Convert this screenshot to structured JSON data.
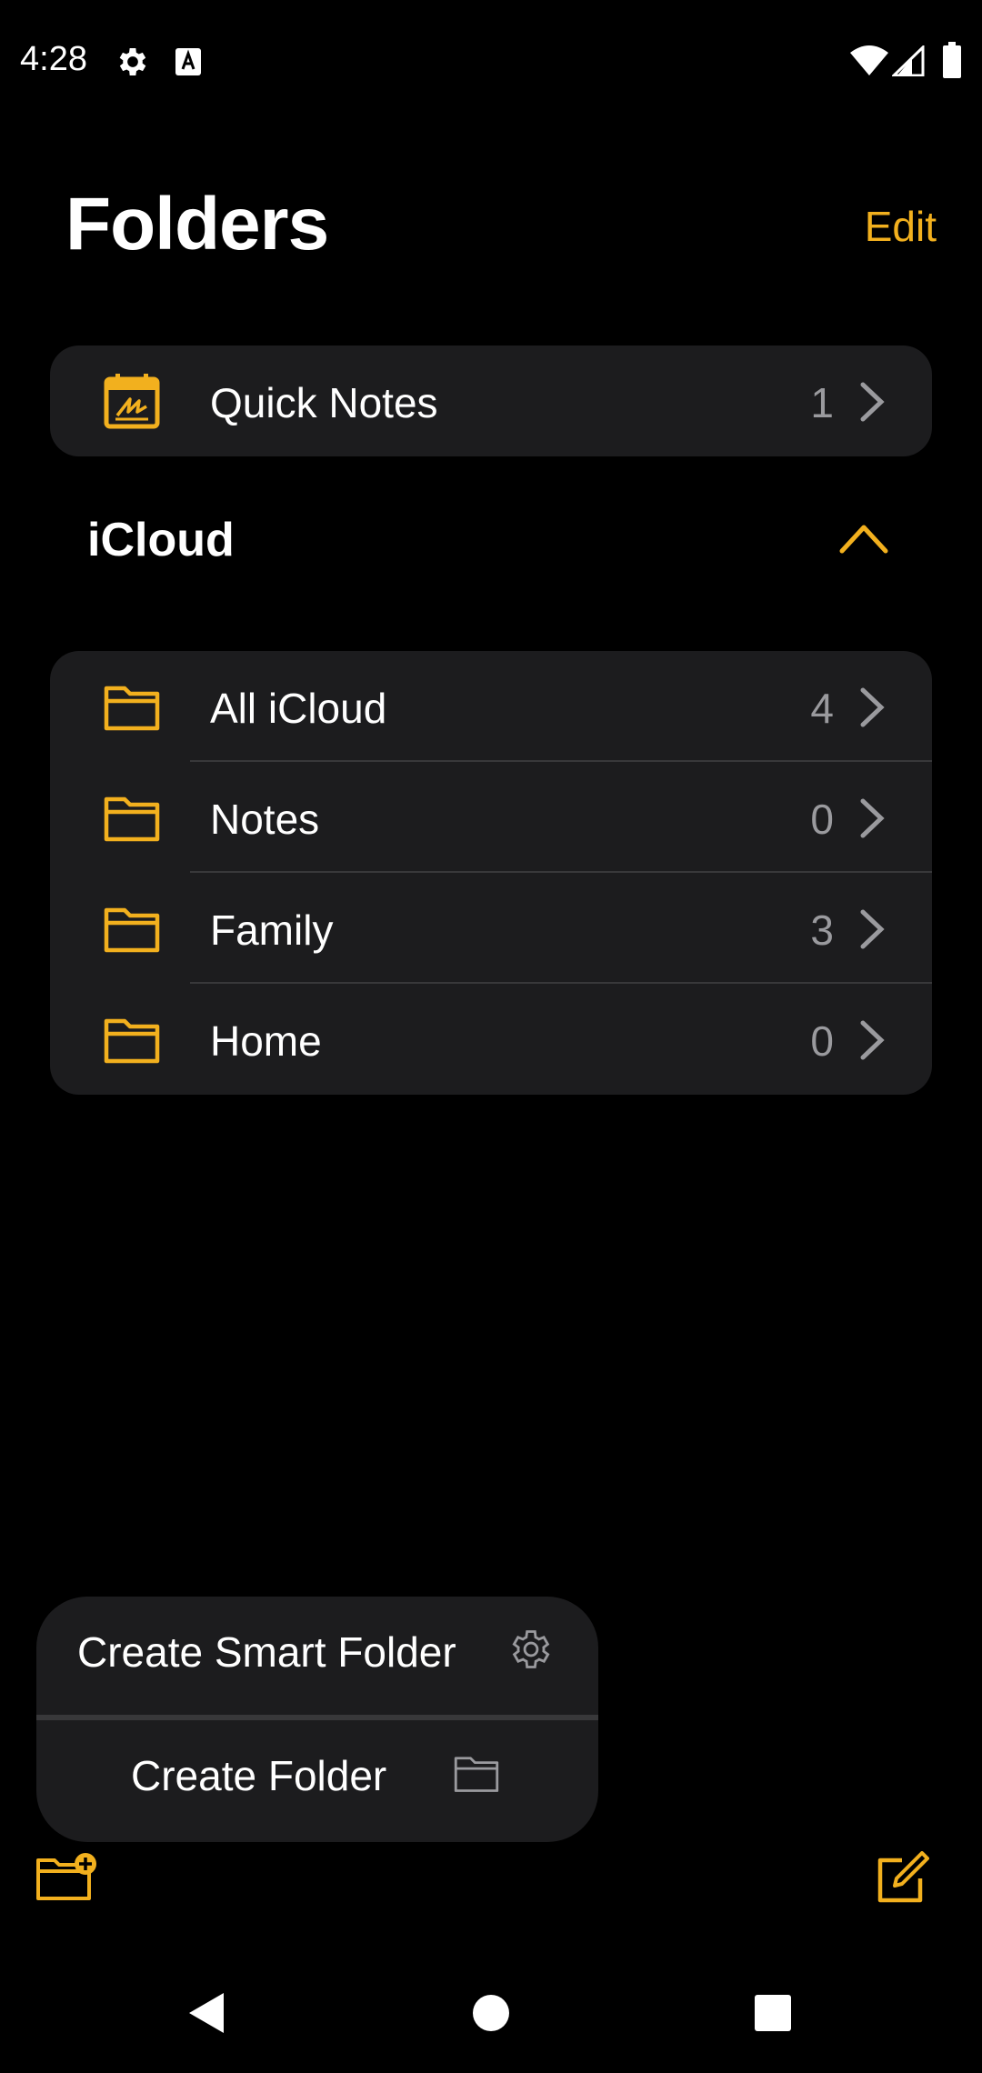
{
  "status_bar": {
    "time": "4:28"
  },
  "header": {
    "title": "Folders",
    "edit_label": "Edit"
  },
  "quick_notes": {
    "label": "Quick Notes",
    "count": "1"
  },
  "icloud_section": {
    "title": "iCloud",
    "expanded": true,
    "folders": [
      {
        "label": "All iCloud",
        "count": "4"
      },
      {
        "label": "Notes",
        "count": "0"
      },
      {
        "label": "Family",
        "count": "3"
      },
      {
        "label": "Home",
        "count": "0"
      }
    ]
  },
  "popup_menu": {
    "items": [
      {
        "label": "Create Smart Folder",
        "icon": "gear-icon"
      },
      {
        "label": "Create Folder",
        "icon": "folder-icon"
      }
    ]
  },
  "toolbar": {
    "new_folder_icon": "folder-plus-icon",
    "compose_icon": "compose-icon"
  },
  "colors": {
    "accent": "#f2b01e",
    "background": "#000000",
    "card": "#1c1c1e",
    "secondary_text": "#9a9a9e"
  }
}
